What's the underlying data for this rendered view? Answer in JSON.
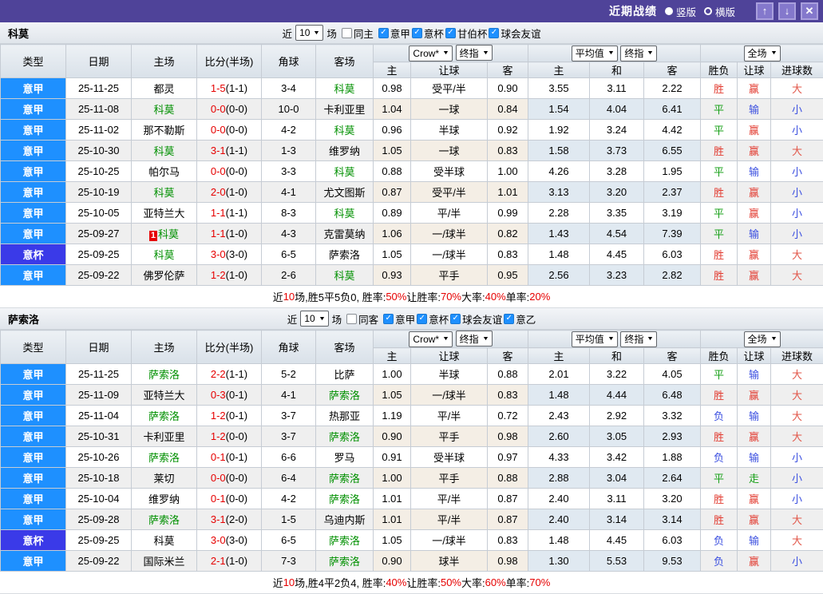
{
  "titlebar": {
    "title": "近期战绩",
    "radio_vertical": "竖版",
    "radio_horizontal": "横版",
    "up_icon": "↑",
    "down_icon": "↓",
    "close_icon": "✕"
  },
  "columns": {
    "type": "类型",
    "date": "日期",
    "home": "主场",
    "score": "比分(半场)",
    "corners": "角球",
    "away": "客场",
    "o_home": "主",
    "o_line": "让球",
    "o_away": "客",
    "a_home": "主",
    "a_draw": "和",
    "a_away": "客",
    "wdl": "胜负",
    "hc": "让球",
    "goals": "进球数",
    "arrow": "▼"
  },
  "league_colors": {
    "意甲": "#1e90ff",
    "意杯": "#3a3ae8"
  },
  "result_colors": {
    "胜": "#e23b30",
    "平": "#18a018",
    "负": "#3b4fe0",
    "赢": "#e23b30",
    "输": "#3b4fe0",
    "走": "#18a018",
    "大": "#e2574a",
    "小": "#3b4fe0"
  },
  "sections": [
    {
      "team": "科莫",
      "filter": {
        "near_label": "近",
        "games_value": "10",
        "games_suffix": "场",
        "same_label": "同主",
        "leagues": [
          "意甲",
          "意杯",
          "甘伯杯",
          "球会友谊"
        ],
        "check_glyph": "✓"
      },
      "dropdowns": {
        "odds1": "Crow*",
        "odds1_final": "终指",
        "odds2": "平均值",
        "odds2_final": "终指",
        "scope": "全场"
      },
      "rows": [
        {
          "league": "意甲",
          "date": "25-11-25",
          "home": "都灵",
          "home_highlight": false,
          "home_badge": null,
          "score": "1-5",
          "half": "(1-1)",
          "corners": "3-4",
          "away": "科莫",
          "away_highlight": true,
          "o1_home": "0.98",
          "o1_line": "受平/半",
          "o1_away": "0.90",
          "o2_home": "3.55",
          "o2_draw": "3.11",
          "o2_away": "2.22",
          "wdl": "胜",
          "hc": "赢",
          "ou": "大"
        },
        {
          "league": "意甲",
          "date": "25-11-08",
          "home": "科莫",
          "home_highlight": true,
          "home_badge": null,
          "score": "0-0",
          "half": "(0-0)",
          "corners": "10-0",
          "away": "卡利亚里",
          "away_highlight": false,
          "o1_home": "1.04",
          "o1_line": "一球",
          "o1_away": "0.84",
          "o2_home": "1.54",
          "o2_draw": "4.04",
          "o2_away": "6.41",
          "wdl": "平",
          "hc": "输",
          "ou": "小"
        },
        {
          "league": "意甲",
          "date": "25-11-02",
          "home": "那不勒斯",
          "home_highlight": false,
          "home_badge": null,
          "score": "0-0",
          "half": "(0-0)",
          "corners": "4-2",
          "away": "科莫",
          "away_highlight": true,
          "o1_home": "0.96",
          "o1_line": "半球",
          "o1_away": "0.92",
          "o2_home": "1.92",
          "o2_draw": "3.24",
          "o2_away": "4.42",
          "wdl": "平",
          "hc": "赢",
          "ou": "小"
        },
        {
          "league": "意甲",
          "date": "25-10-30",
          "home": "科莫",
          "home_highlight": true,
          "home_badge": null,
          "score": "3-1",
          "half": "(1-1)",
          "corners": "1-3",
          "away": "维罗纳",
          "away_highlight": false,
          "o1_home": "1.05",
          "o1_line": "一球",
          "o1_away": "0.83",
          "o2_home": "1.58",
          "o2_draw": "3.73",
          "o2_away": "6.55",
          "wdl": "胜",
          "hc": "赢",
          "ou": "大"
        },
        {
          "league": "意甲",
          "date": "25-10-25",
          "home": "帕尔马",
          "home_highlight": false,
          "home_badge": null,
          "score": "0-0",
          "half": "(0-0)",
          "corners": "3-3",
          "away": "科莫",
          "away_highlight": true,
          "o1_home": "0.88",
          "o1_line": "受半球",
          "o1_away": "1.00",
          "o2_home": "4.26",
          "o2_draw": "3.28",
          "o2_away": "1.95",
          "wdl": "平",
          "hc": "输",
          "ou": "小"
        },
        {
          "league": "意甲",
          "date": "25-10-19",
          "home": "科莫",
          "home_highlight": true,
          "home_badge": null,
          "score": "2-0",
          "half": "(1-0)",
          "corners": "4-1",
          "away": "尤文图斯",
          "away_highlight": false,
          "o1_home": "0.87",
          "o1_line": "受平/半",
          "o1_away": "1.01",
          "o2_home": "3.13",
          "o2_draw": "3.20",
          "o2_away": "2.37",
          "wdl": "胜",
          "hc": "赢",
          "ou": "小"
        },
        {
          "league": "意甲",
          "date": "25-10-05",
          "home": "亚特兰大",
          "home_highlight": false,
          "home_badge": null,
          "score": "1-1",
          "half": "(1-1)",
          "corners": "8-3",
          "away": "科莫",
          "away_highlight": true,
          "o1_home": "0.89",
          "o1_line": "平/半",
          "o1_away": "0.99",
          "o2_home": "2.28",
          "o2_draw": "3.35",
          "o2_away": "3.19",
          "wdl": "平",
          "hc": "赢",
          "ou": "小"
        },
        {
          "league": "意甲",
          "date": "25-09-27",
          "home": "科莫",
          "home_highlight": true,
          "home_badge": "1",
          "score": "1-1",
          "half": "(1-0)",
          "corners": "4-3",
          "away": "克雷莫纳",
          "away_highlight": false,
          "o1_home": "1.06",
          "o1_line": "一/球半",
          "o1_away": "0.82",
          "o2_home": "1.43",
          "o2_draw": "4.54",
          "o2_away": "7.39",
          "wdl": "平",
          "hc": "输",
          "ou": "小"
        },
        {
          "league": "意杯",
          "date": "25-09-25",
          "home": "科莫",
          "home_highlight": true,
          "home_badge": null,
          "score": "3-0",
          "half": "(3-0)",
          "corners": "6-5",
          "away": "萨索洛",
          "away_highlight": false,
          "o1_home": "1.05",
          "o1_line": "一/球半",
          "o1_away": "0.83",
          "o2_home": "1.48",
          "o2_draw": "4.45",
          "o2_away": "6.03",
          "wdl": "胜",
          "hc": "赢",
          "ou": "大"
        },
        {
          "league": "意甲",
          "date": "25-09-22",
          "home": "佛罗伦萨",
          "home_highlight": false,
          "home_badge": null,
          "score": "1-2",
          "half": "(1-0)",
          "corners": "2-6",
          "away": "科莫",
          "away_highlight": true,
          "o1_home": "0.93",
          "o1_line": "平手",
          "o1_away": "0.95",
          "o2_home": "2.56",
          "o2_draw": "3.23",
          "o2_away": "2.82",
          "wdl": "胜",
          "hc": "赢",
          "ou": "大"
        }
      ],
      "summary": [
        {
          "t": "近"
        },
        {
          "t": "10",
          "red": true
        },
        {
          "t": "场,胜5平5负0, 胜率:"
        },
        {
          "t": "50%",
          "red": true
        },
        {
          "t": " 让胜率:"
        },
        {
          "t": "70%",
          "red": true
        },
        {
          "t": " 大率:"
        },
        {
          "t": "40%",
          "red": true
        },
        {
          "t": " 单率:"
        },
        {
          "t": "20%",
          "red": true
        }
      ]
    },
    {
      "team": "萨索洛",
      "filter": {
        "near_label": "近",
        "games_value": "10",
        "games_suffix": "场",
        "same_label": "同客",
        "leagues": [
          "意甲",
          "意杯",
          "球会友谊",
          "意乙"
        ],
        "check_glyph": "✓"
      },
      "dropdowns": {
        "odds1": "Crow*",
        "odds1_final": "终指",
        "odds2": "平均值",
        "odds2_final": "终指",
        "scope": "全场"
      },
      "rows": [
        {
          "league": "意甲",
          "date": "25-11-25",
          "home": "萨索洛",
          "home_highlight": true,
          "home_badge": null,
          "score": "2-2",
          "half": "(1-1)",
          "corners": "5-2",
          "away": "比萨",
          "away_highlight": false,
          "o1_home": "1.00",
          "o1_line": "半球",
          "o1_away": "0.88",
          "o2_home": "2.01",
          "o2_draw": "3.22",
          "o2_away": "4.05",
          "wdl": "平",
          "hc": "输",
          "ou": "大"
        },
        {
          "league": "意甲",
          "date": "25-11-09",
          "home": "亚特兰大",
          "home_highlight": false,
          "home_badge": null,
          "score": "0-3",
          "half": "(0-1)",
          "corners": "4-1",
          "away": "萨索洛",
          "away_highlight": true,
          "o1_home": "1.05",
          "o1_line": "一/球半",
          "o1_away": "0.83",
          "o2_home": "1.48",
          "o2_draw": "4.44",
          "o2_away": "6.48",
          "wdl": "胜",
          "hc": "赢",
          "ou": "大"
        },
        {
          "league": "意甲",
          "date": "25-11-04",
          "home": "萨索洛",
          "home_highlight": true,
          "home_badge": null,
          "score": "1-2",
          "half": "(0-1)",
          "corners": "3-7",
          "away": "热那亚",
          "away_highlight": false,
          "o1_home": "1.19",
          "o1_line": "平/半",
          "o1_away": "0.72",
          "o2_home": "2.43",
          "o2_draw": "2.92",
          "o2_away": "3.32",
          "wdl": "负",
          "hc": "输",
          "ou": "大"
        },
        {
          "league": "意甲",
          "date": "25-10-31",
          "home": "卡利亚里",
          "home_highlight": false,
          "home_badge": null,
          "score": "1-2",
          "half": "(0-0)",
          "corners": "3-7",
          "away": "萨索洛",
          "away_highlight": true,
          "o1_home": "0.90",
          "o1_line": "平手",
          "o1_away": "0.98",
          "o2_home": "2.60",
          "o2_draw": "3.05",
          "o2_away": "2.93",
          "wdl": "胜",
          "hc": "赢",
          "ou": "大"
        },
        {
          "league": "意甲",
          "date": "25-10-26",
          "home": "萨索洛",
          "home_highlight": true,
          "home_badge": null,
          "score": "0-1",
          "half": "(0-1)",
          "corners": "6-6",
          "away": "罗马",
          "away_highlight": false,
          "o1_home": "0.91",
          "o1_line": "受半球",
          "o1_away": "0.97",
          "o2_home": "4.33",
          "o2_draw": "3.42",
          "o2_away": "1.88",
          "wdl": "负",
          "hc": "输",
          "ou": "小"
        },
        {
          "league": "意甲",
          "date": "25-10-18",
          "home": "莱切",
          "home_highlight": false,
          "home_badge": null,
          "score": "0-0",
          "half": "(0-0)",
          "corners": "6-4",
          "away": "萨索洛",
          "away_highlight": true,
          "o1_home": "1.00",
          "o1_line": "平手",
          "o1_away": "0.88",
          "o2_home": "2.88",
          "o2_draw": "3.04",
          "o2_away": "2.64",
          "wdl": "平",
          "hc": "走",
          "ou": "小"
        },
        {
          "league": "意甲",
          "date": "25-10-04",
          "home": "维罗纳",
          "home_highlight": false,
          "home_badge": null,
          "score": "0-1",
          "half": "(0-0)",
          "corners": "4-2",
          "away": "萨索洛",
          "away_highlight": true,
          "o1_home": "1.01",
          "o1_line": "平/半",
          "o1_away": "0.87",
          "o2_home": "2.40",
          "o2_draw": "3.11",
          "o2_away": "3.20",
          "wdl": "胜",
          "hc": "赢",
          "ou": "小"
        },
        {
          "league": "意甲",
          "date": "25-09-28",
          "home": "萨索洛",
          "home_highlight": true,
          "home_badge": null,
          "score": "3-1",
          "half": "(2-0)",
          "corners": "1-5",
          "away": "乌迪内斯",
          "away_highlight": false,
          "o1_home": "1.01",
          "o1_line": "平/半",
          "o1_away": "0.87",
          "o2_home": "2.40",
          "o2_draw": "3.14",
          "o2_away": "3.14",
          "wdl": "胜",
          "hc": "赢",
          "ou": "大"
        },
        {
          "league": "意杯",
          "date": "25-09-25",
          "home": "科莫",
          "home_highlight": false,
          "home_badge": null,
          "score": "3-0",
          "half": "(3-0)",
          "corners": "6-5",
          "away": "萨索洛",
          "away_highlight": true,
          "o1_home": "1.05",
          "o1_line": "一/球半",
          "o1_away": "0.83",
          "o2_home": "1.48",
          "o2_draw": "4.45",
          "o2_away": "6.03",
          "wdl": "负",
          "hc": "输",
          "ou": "大"
        },
        {
          "league": "意甲",
          "date": "25-09-22",
          "home": "国际米兰",
          "home_highlight": false,
          "home_badge": null,
          "score": "2-1",
          "half": "(1-0)",
          "corners": "7-3",
          "away": "萨索洛",
          "away_highlight": true,
          "o1_home": "0.90",
          "o1_line": "球半",
          "o1_away": "0.98",
          "o2_home": "1.30",
          "o2_draw": "5.53",
          "o2_away": "9.53",
          "wdl": "负",
          "hc": "赢",
          "ou": "小"
        }
      ],
      "summary": [
        {
          "t": "近"
        },
        {
          "t": "10",
          "red": true
        },
        {
          "t": "场,胜4平2负4, 胜率:"
        },
        {
          "t": "40%",
          "red": true
        },
        {
          "t": " 让胜率:"
        },
        {
          "t": "50%",
          "red": true
        },
        {
          "t": " 大率:"
        },
        {
          "t": "60%",
          "red": true
        },
        {
          "t": " 单率:"
        },
        {
          "t": "70%",
          "red": true
        }
      ]
    }
  ]
}
